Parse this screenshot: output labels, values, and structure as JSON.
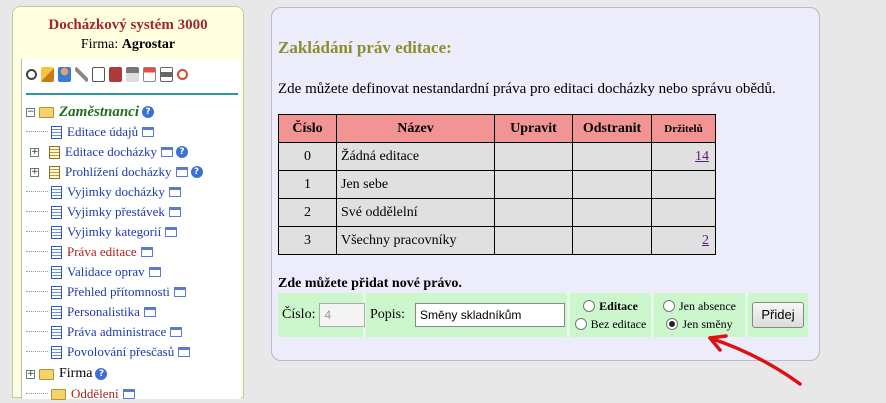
{
  "sidebar": {
    "system_title": "Docházkový systém 3000",
    "firm_label": "Firma:",
    "firm_name": "Agrostar",
    "toolbar_icons": [
      "search-icon",
      "pencil-icon",
      "users-icon",
      "key-icon",
      "copy-icon",
      "book-icon",
      "house-icon",
      "network-icon",
      "printer-icon",
      "power-icon"
    ],
    "section_employees": "Zaměstnanci",
    "items": [
      {
        "label": "Editace údajů"
      },
      {
        "label": "Editace docházky"
      },
      {
        "label": "Prohlížení docházky"
      },
      {
        "label": "Vyjimky docházky"
      },
      {
        "label": "Vyjimky přestávek"
      },
      {
        "label": "Vyjimky kategorií"
      },
      {
        "label": "Práva editace"
      },
      {
        "label": "Validace oprav"
      },
      {
        "label": "Přehled přítomnosti"
      },
      {
        "label": "Personalistika"
      },
      {
        "label": "Práva administrace"
      },
      {
        "label": "Povolování přesčasů"
      }
    ],
    "section_firm": "Firma",
    "firm_child": "Oddělení"
  },
  "main": {
    "title": "Zakládání práv editace:",
    "description": "Zde můžete definovat nestandardní práva pro editaci docházky nebo správu obědů.",
    "table": {
      "headers": {
        "num": "Číslo",
        "name": "Název",
        "edit": "Upravit",
        "remove": "Odstranit",
        "holders": "Držitelů"
      },
      "rows": [
        {
          "num": "0",
          "name": "Žádná editace",
          "holders": "14"
        },
        {
          "num": "1",
          "name": "Jen sebe",
          "holders": ""
        },
        {
          "num": "2",
          "name": "Své oddělelní",
          "holders": ""
        },
        {
          "num": "3",
          "name": "Všechny pracovníky",
          "holders": "2"
        }
      ]
    },
    "add": {
      "title": "Zde můžete přidat nové právo.",
      "num_label": "Číslo:",
      "num_value": "4",
      "desc_label": "Popis:",
      "desc_value": "Směny skladníkům",
      "opt_editace": "Editace",
      "opt_bez_editace": "Bez editace",
      "opt_jen_absence": "Jen absence",
      "opt_jen_smeny": "Jen směny",
      "submit": "Přidej"
    }
  },
  "colors": {
    "title": "#8c8e2c",
    "header_bg": "#f29494",
    "form_bg": "#ccf6cc",
    "arrow": "#e01010"
  }
}
